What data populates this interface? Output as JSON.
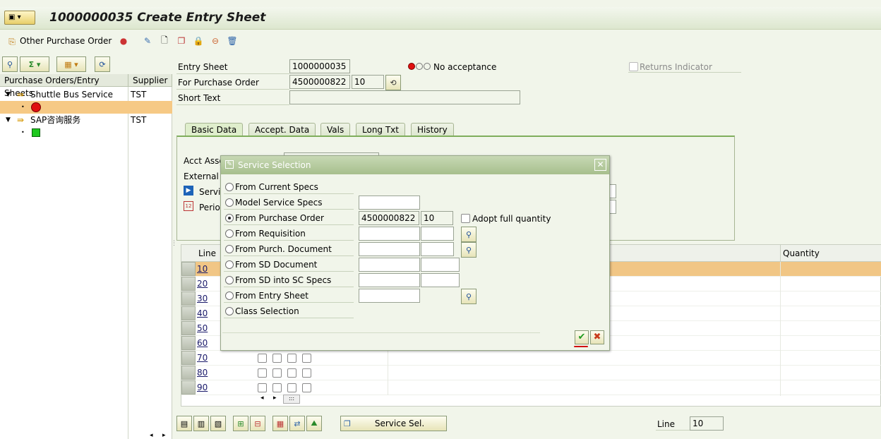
{
  "window": {
    "title": "1000000035 Create Entry Sheet"
  },
  "toolbar": {
    "other_po_label": "Other Purchase Order"
  },
  "left_pane": {
    "col1": "Purchase Orders/Entry Sheets",
    "col2": "Supplier",
    "rows": [
      {
        "label": "Shuttle Bus Service",
        "supplier": "TST"
      },
      {
        "label": "SAP咨询服务",
        "supplier": "TST"
      }
    ]
  },
  "header": {
    "entry_sheet_label": "Entry Sheet",
    "entry_sheet_value": "1000000035",
    "acceptance_text": "No acceptance",
    "returns_label": "Returns Indicator",
    "po_label": "For Purchase Order",
    "po_value": "4500000822",
    "po_item": "10",
    "short_text_label": "Short Text",
    "short_text_value": ""
  },
  "tabs": [
    "Basic Data",
    "Accept. Data",
    "Vals",
    "Long Txt",
    "History"
  ],
  "basic_data": {
    "acct_assg": "Acct Assg",
    "external": "External N",
    "service": "Servic",
    "period": "Perio"
  },
  "grid": {
    "col_line": "Line",
    "col_quantity": "Quantity",
    "lines": [
      "10",
      "20",
      "30",
      "40",
      "50",
      "60",
      "70",
      "80",
      "90"
    ]
  },
  "bottom": {
    "service_sel_button": "Service Sel.",
    "line_label": "Line",
    "line_value": "10"
  },
  "dialog": {
    "title": "Service Selection",
    "options": [
      {
        "label": "From Current Specs",
        "selected": false
      },
      {
        "label": "Model Service Specs",
        "selected": false
      },
      {
        "label": "From Purchase Order",
        "selected": true
      },
      {
        "label": "From Requisition",
        "selected": false
      },
      {
        "label": "From Purch. Document",
        "selected": false
      },
      {
        "label": "From SD Document",
        "selected": false
      },
      {
        "label": "From SD into SC Specs",
        "selected": false
      },
      {
        "label": "From Entry Sheet",
        "selected": false
      },
      {
        "label": "Class Selection",
        "selected": false
      }
    ],
    "po_number": "4500000822",
    "po_item": "10",
    "adopt_label": "Adopt full quantity"
  }
}
